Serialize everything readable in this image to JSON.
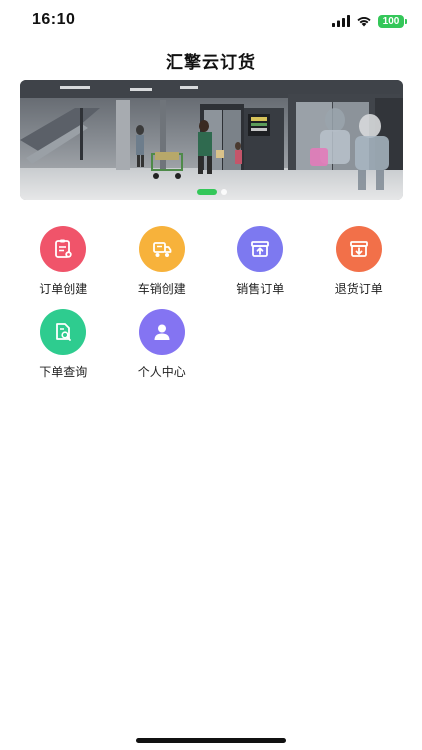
{
  "status_bar": {
    "time": "16:10",
    "battery": "100",
    "signal_icon": "cellular-signal-icon",
    "wifi_icon": "wifi-icon"
  },
  "nav": {
    "title": "汇擎云订货"
  },
  "banner": {
    "description_icon": "mall-escalator-photo",
    "slide_count": 2,
    "active_slide": 1
  },
  "menu": {
    "items": [
      {
        "label": "订单创建",
        "icon": "order-create-icon",
        "color": "#f0546a"
      },
      {
        "label": "车销创建",
        "icon": "cart-sale-icon",
        "color": "#f7b23b"
      },
      {
        "label": "销售订单",
        "icon": "box-upload-icon",
        "color": "#7d79f0"
      },
      {
        "label": "退货订单",
        "icon": "box-download-icon",
        "color": "#f27049"
      },
      {
        "label": "下单查询",
        "icon": "order-search-icon",
        "color": "#2ecc8f"
      },
      {
        "label": "个人中心",
        "icon": "person-icon",
        "color": "#8474f2"
      }
    ]
  },
  "colors": {
    "accent_green": "#34c759",
    "background": "#ffffff"
  }
}
